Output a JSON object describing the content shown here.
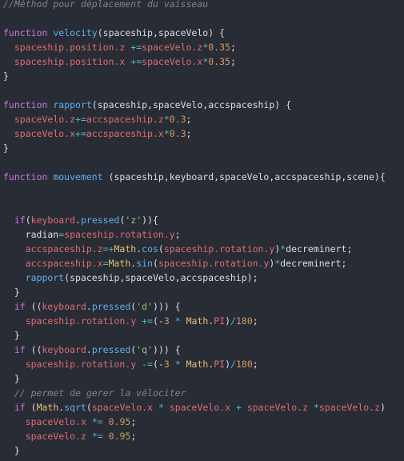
{
  "editor": {
    "theme_colors": {
      "background": "#282c34",
      "keyword": "#c678dd",
      "function": "#61afef",
      "variable": "#e06c75",
      "operator": "#56b6c2",
      "number": "#d19a66",
      "string": "#98c379",
      "comment": "#7f848e",
      "class": "#e5c07b",
      "plain": "#dcdfe4"
    },
    "lines": [
      [
        [
          "cm",
          "//Méthod pour déplacement du vaisseau"
        ]
      ],
      [],
      [
        [
          "kw",
          "function"
        ],
        [
          "pl",
          " "
        ],
        [
          "fn",
          "velocity"
        ],
        [
          "pl",
          "(spaceship,spaceVelo) {"
        ]
      ],
      [
        [
          "pl",
          "  "
        ],
        [
          "var",
          "spaceship.position.z"
        ],
        [
          "pl",
          " "
        ],
        [
          "op",
          "+="
        ],
        [
          "var",
          "spaceVelo.z"
        ],
        [
          "op",
          "*"
        ],
        [
          "num",
          "0.35"
        ],
        [
          "pl",
          ";"
        ]
      ],
      [
        [
          "pl",
          "  "
        ],
        [
          "var",
          "spaceship.position.x"
        ],
        [
          "pl",
          " "
        ],
        [
          "op",
          "+="
        ],
        [
          "var",
          "spaceVelo.x"
        ],
        [
          "op",
          "*"
        ],
        [
          "num",
          "0.35"
        ],
        [
          "pl",
          ";"
        ]
      ],
      [
        [
          "pl",
          "}"
        ]
      ],
      [],
      [
        [
          "kw",
          "function"
        ],
        [
          "pl",
          " "
        ],
        [
          "fn",
          "rapport"
        ],
        [
          "pl",
          "(spaceship,spaceVelo,accspaceship) {"
        ]
      ],
      [
        [
          "pl",
          "  "
        ],
        [
          "var",
          "spaceVelo.z"
        ],
        [
          "op",
          "+="
        ],
        [
          "var",
          "accspaceship.z"
        ],
        [
          "op",
          "*"
        ],
        [
          "num",
          "0.3"
        ],
        [
          "pl",
          ";"
        ]
      ],
      [
        [
          "pl",
          "  "
        ],
        [
          "var",
          "spaceVelo.x"
        ],
        [
          "op",
          "+="
        ],
        [
          "var",
          "accspaceship.x"
        ],
        [
          "op",
          "*"
        ],
        [
          "num",
          "0.3"
        ],
        [
          "pl",
          ";"
        ]
      ],
      [
        [
          "pl",
          "}"
        ]
      ],
      [],
      [
        [
          "kw",
          "function"
        ],
        [
          "pl",
          " "
        ],
        [
          "fn",
          "mouvement"
        ],
        [
          "pl",
          " (spaceship,keyboard,spaceVelo,accspaceship,scene){"
        ]
      ],
      [],
      [],
      [
        [
          "pl",
          "  "
        ],
        [
          "kw",
          "if"
        ],
        [
          "pl",
          "("
        ],
        [
          "var",
          "keyboard"
        ],
        [
          "pl",
          "."
        ],
        [
          "fn",
          "pressed"
        ],
        [
          "pl",
          "("
        ],
        [
          "str",
          "'z'"
        ],
        [
          "pl",
          "))"
        ],
        [
          "pl",
          "{"
        ]
      ],
      [
        [
          "pl",
          "    radian"
        ],
        [
          "op",
          "="
        ],
        [
          "var",
          "spaceship.rotation.y"
        ],
        [
          "pl",
          ";"
        ]
      ],
      [
        [
          "pl",
          "    "
        ],
        [
          "var",
          "accspaceship.z"
        ],
        [
          "op",
          "=+"
        ],
        [
          "cls",
          "Math"
        ],
        [
          "pl",
          "."
        ],
        [
          "fn",
          "cos"
        ],
        [
          "pl",
          "("
        ],
        [
          "var",
          "spaceship.rotation.y"
        ],
        [
          "pl",
          ")"
        ],
        [
          "op",
          "*"
        ],
        [
          "pl",
          "decreminert;"
        ]
      ],
      [
        [
          "pl",
          "    "
        ],
        [
          "var",
          "accspaceship.x"
        ],
        [
          "op",
          "="
        ],
        [
          "cls",
          "Math"
        ],
        [
          "pl",
          "."
        ],
        [
          "fn",
          "sin"
        ],
        [
          "pl",
          "("
        ],
        [
          "var",
          "spaceship.rotation.y"
        ],
        [
          "pl",
          ")"
        ],
        [
          "op",
          "*"
        ],
        [
          "pl",
          "decreminert;"
        ]
      ],
      [
        [
          "pl",
          "    "
        ],
        [
          "fn",
          "rapport"
        ],
        [
          "pl",
          "(spaceship,spaceVelo,accspaceship);"
        ]
      ],
      [
        [
          "pl",
          "  }"
        ]
      ],
      [
        [
          "pl",
          "  "
        ],
        [
          "kw",
          "if"
        ],
        [
          "pl",
          " (("
        ],
        [
          "var",
          "keyboard"
        ],
        [
          "pl",
          "."
        ],
        [
          "fn",
          "pressed"
        ],
        [
          "pl",
          "("
        ],
        [
          "str",
          "'d'"
        ],
        [
          "pl",
          ")))"
        ],
        [
          "pl",
          " {"
        ]
      ],
      [
        [
          "pl",
          "    "
        ],
        [
          "var",
          "spaceship.rotation.y"
        ],
        [
          "pl",
          " "
        ],
        [
          "op",
          "+="
        ],
        [
          "pl",
          "(-"
        ],
        [
          "num",
          "3"
        ],
        [
          "pl",
          " "
        ],
        [
          "op",
          "*"
        ],
        [
          "pl",
          " "
        ],
        [
          "cls",
          "Math"
        ],
        [
          "pl",
          "."
        ],
        [
          "var",
          "PI"
        ],
        [
          "pl",
          ")"
        ],
        [
          "op",
          "/"
        ],
        [
          "num",
          "180"
        ],
        [
          "pl",
          ";"
        ]
      ],
      [
        [
          "pl",
          "  }"
        ]
      ],
      [
        [
          "pl",
          "  "
        ],
        [
          "kw",
          "if"
        ],
        [
          "pl",
          " (("
        ],
        [
          "var",
          "keyboard"
        ],
        [
          "pl",
          "."
        ],
        [
          "fn",
          "pressed"
        ],
        [
          "pl",
          "("
        ],
        [
          "str",
          "'q'"
        ],
        [
          "pl",
          ")))"
        ],
        [
          "pl",
          " {"
        ]
      ],
      [
        [
          "pl",
          "    "
        ],
        [
          "var",
          "spaceship.rotation.y"
        ],
        [
          "pl",
          " "
        ],
        [
          "op",
          "-="
        ],
        [
          "pl",
          "(-"
        ],
        [
          "num",
          "3"
        ],
        [
          "pl",
          " "
        ],
        [
          "op",
          "*"
        ],
        [
          "pl",
          " "
        ],
        [
          "cls",
          "Math"
        ],
        [
          "pl",
          "."
        ],
        [
          "var",
          "PI"
        ],
        [
          "pl",
          ")"
        ],
        [
          "op",
          "/"
        ],
        [
          "num",
          "180"
        ],
        [
          "pl",
          ";"
        ]
      ],
      [
        [
          "pl",
          "  }"
        ]
      ],
      [
        [
          "pl",
          "  "
        ],
        [
          "cm",
          "// permet de gerer la vélociter"
        ]
      ],
      [
        [
          "pl",
          "  "
        ],
        [
          "kw",
          "if"
        ],
        [
          "pl",
          " ("
        ],
        [
          "cls",
          "Math"
        ],
        [
          "pl",
          "."
        ],
        [
          "fn",
          "sqrt"
        ],
        [
          "pl",
          "("
        ],
        [
          "var",
          "spaceVelo.x"
        ],
        [
          "pl",
          " "
        ],
        [
          "op",
          "*"
        ],
        [
          "pl",
          " "
        ],
        [
          "var",
          "spaceVelo.x"
        ],
        [
          "pl",
          " "
        ],
        [
          "op",
          "+"
        ],
        [
          "pl",
          " "
        ],
        [
          "var",
          "spaceVelo.z"
        ],
        [
          "pl",
          " "
        ],
        [
          "op",
          "*"
        ],
        [
          "var",
          "spaceVelo.z"
        ],
        [
          "pl",
          ")"
        ]
      ],
      [
        [
          "pl",
          "    "
        ],
        [
          "var",
          "spaceVelo.x"
        ],
        [
          "pl",
          " "
        ],
        [
          "op",
          "*="
        ],
        [
          "pl",
          " "
        ],
        [
          "num",
          "0.95"
        ],
        [
          "pl",
          ";"
        ]
      ],
      [
        [
          "pl",
          "    "
        ],
        [
          "var",
          "spaceVelo.z"
        ],
        [
          "pl",
          " "
        ],
        [
          "op",
          "*="
        ],
        [
          "pl",
          " "
        ],
        [
          "num",
          "0.95"
        ],
        [
          "pl",
          ";"
        ]
      ],
      [
        [
          "pl",
          "  }"
        ]
      ]
    ]
  }
}
